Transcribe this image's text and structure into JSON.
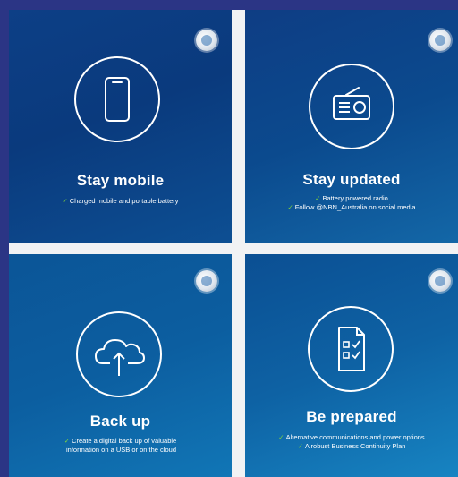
{
  "tiles": [
    {
      "title": "Stay mobile",
      "icon": "mobile-phone-icon",
      "items": [
        {
          "check": "✓",
          "text": "Charged mobile and portable battery"
        }
      ]
    },
    {
      "title": "Stay updated",
      "icon": "radio-icon",
      "items": [
        {
          "check": "✓",
          "text": "Battery powered radio"
        },
        {
          "check": "✓",
          "text": "Follow @NBN_Australia on social media"
        }
      ]
    },
    {
      "title": "Back up",
      "icon": "cloud-upload-icon",
      "items": [
        {
          "check": "✓",
          "text": "Create a digital back up of valuable"
        },
        {
          "check": "",
          "text": "information on a USB or on the cloud"
        }
      ]
    },
    {
      "title": "Be prepared",
      "icon": "checklist-document-icon",
      "items": [
        {
          "check": "✓",
          "text": "Alternative communications and power options"
        },
        {
          "check": "✓",
          "text": "A robust Business Continuity Plan"
        }
      ]
    }
  ],
  "colors": {
    "frame": "#2b3585",
    "tile_dark": "#0a3a7d",
    "tile_light": "#1784c2",
    "check": "#7fd43b",
    "text": "#ffffff"
  },
  "badge_icon": "nbn-australia-badge-icon"
}
